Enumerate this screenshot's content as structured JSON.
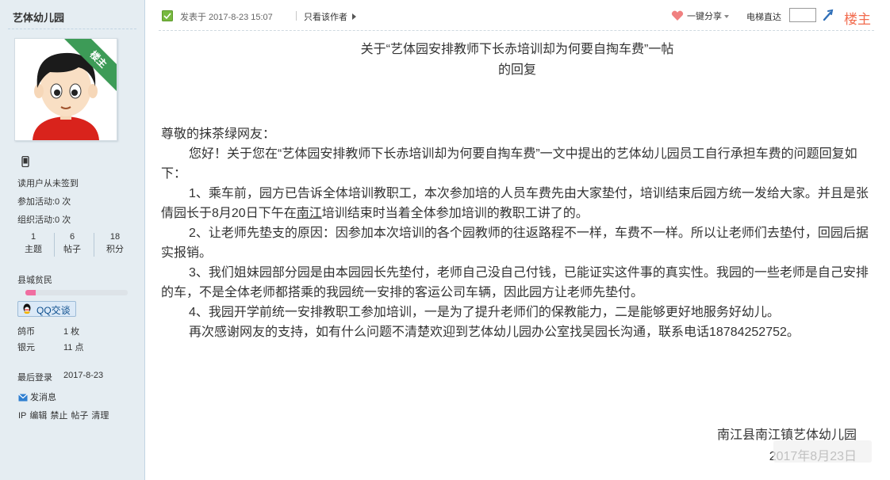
{
  "sidebar": {
    "author_name": "艺体幼儿园",
    "avatar_badge": "楼主",
    "checkin_status": "读用户从未签到",
    "activities_joined": "参加活动:0 次",
    "activities_organized": "组织活动:0 次",
    "stats": [
      {
        "value": "1",
        "label": "主题"
      },
      {
        "value": "6",
        "label": "帖子"
      },
      {
        "value": "18",
        "label": "积分"
      }
    ],
    "user_group": "县城贫民",
    "level_progress": 0.1,
    "qq_button": "QQ交谈",
    "currency": [
      {
        "name": "鸽币",
        "value": "1 枚"
      },
      {
        "name": "银元",
        "value": "11 点"
      }
    ],
    "last_login_label": "最后登录",
    "last_login_date": "2017-8-23",
    "send_message": "发消息",
    "admin_links": [
      "IP",
      "编辑",
      "禁止",
      "帖子",
      "清理"
    ]
  },
  "post_header": {
    "post_time": "发表于 2017-8-23 15:07",
    "only_author": "只看该作者",
    "share": "一键分享",
    "elevator": "电梯直达",
    "floor_input_value": "",
    "floor_label": "楼主"
  },
  "post": {
    "title_line1": "关于“艺体园安排教师下长赤培训却为何要自掏车费”一帖",
    "title_line2": "的回复",
    "greeting": "尊敬的抹茶绿网友：",
    "intro": "您好！关于您在“艺体园安排教师下长赤培训却为何要自掏车费”一文中提出的艺体幼儿园员工自行承担车费的问题回复如下：",
    "item1_before": "1、乘车前，园方已告诉全体培训教职工，本次参加培的人员车费先由大家垫付，培训结束后园方统一发给大家。并且是张倩园长于8月20日下午在",
    "item1_link": "南江",
    "item1_after": "培训结束时当着全体参加培训的教职工讲了的。",
    "item2": "2、让老师先垫支的原因：因参加本次培训的各个园教师的往返路程不一样，车费不一样。所以让老师们去垫付，回园后据实报销。",
    "item3": "3、我们姐妹园部分园是由本园园长先垫付，老师自己没自己付钱，已能证实这件事的真实性。我园的一些老师是自己安排的车，不是全体老师都搭乘的我园统一安排的客运公司车辆，因此园方让老师先垫付。",
    "item4": "4、我园开学前统一安排教职工参加培训，一是为了提升老师们的保教能力，二是能够更好地服务好幼儿。",
    "closing": "再次感谢网友的支持，如有什么问题不清楚欢迎到艺体幼儿园办公室找吴园长沟通，联系电话18784252752。",
    "signature_org": "南江县南江镇艺体幼儿园",
    "signature_date": "2017年8月23日"
  },
  "colors": {
    "sidebar_bg": "#e5edf2",
    "badge_green": "#3d9b57",
    "floor_orange": "#f26c4f",
    "level_pink": "#f06ea1"
  }
}
